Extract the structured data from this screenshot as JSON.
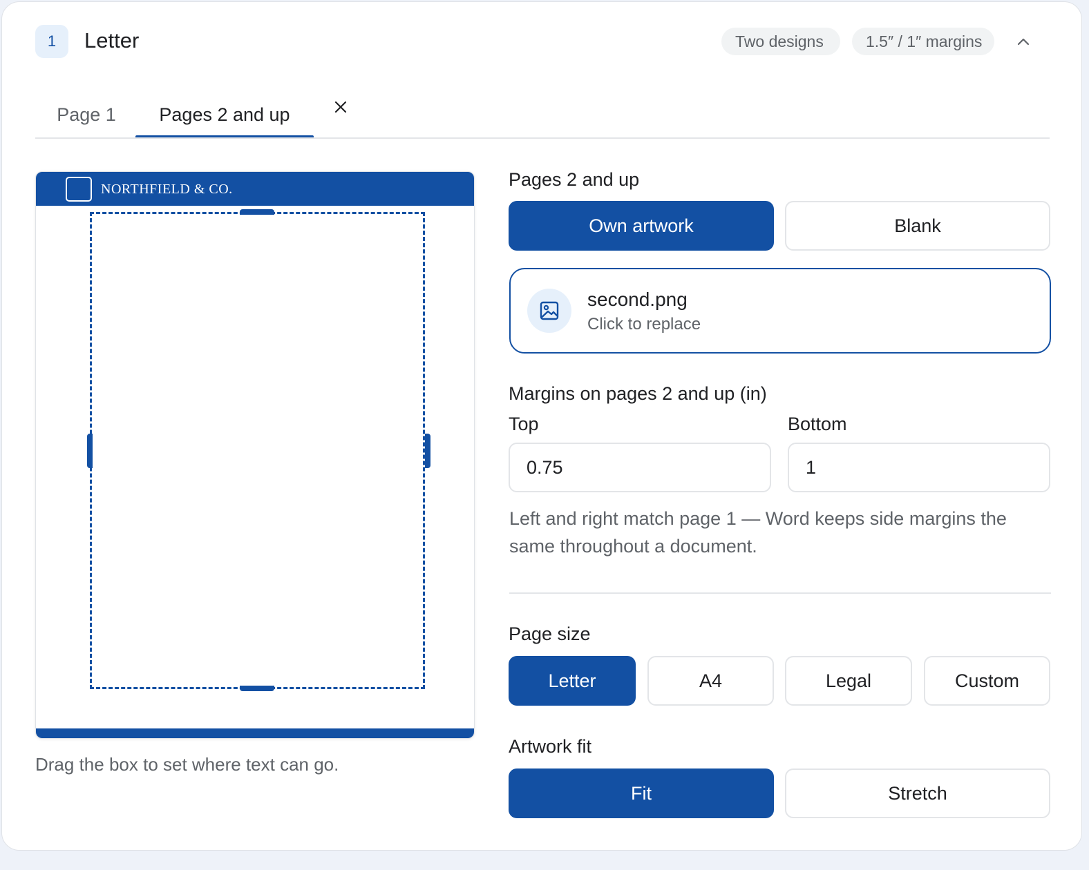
{
  "header": {
    "step_number": "1",
    "title": "Letter",
    "chips": [
      "Two designs",
      "1.5″ / 1″ margins"
    ],
    "collapse_icon": "chevron-up-icon"
  },
  "tabs": [
    {
      "label": "Page 1",
      "active": false
    },
    {
      "label": "Pages 2 and up",
      "active": true
    }
  ],
  "preview": {
    "company_name": "NORTHFIELD & CO.",
    "caption": "Drag the box to set where text can go."
  },
  "pages_section": {
    "label": "Pages 2 and up",
    "options": [
      "Own artwork",
      "Blank"
    ],
    "selected": "Own artwork"
  },
  "file": {
    "icon": "image-icon",
    "name": "second.png",
    "action": "Click to replace"
  },
  "margins": {
    "label": "Margins on pages 2 and up (in)",
    "top_label": "Top",
    "top_value": "0.75",
    "bottom_label": "Bottom",
    "bottom_value": "1",
    "helper": "Left and right match page 1 — Word keeps side margins the same throughout a document."
  },
  "page_size": {
    "label": "Page size",
    "options": [
      "Letter",
      "A4",
      "Legal",
      "Custom"
    ],
    "selected": "Letter"
  },
  "artwork_fit": {
    "label": "Artwork fit",
    "options": [
      "Fit",
      "Stretch"
    ],
    "selected": "Fit"
  },
  "colors": {
    "accent": "#1350a3",
    "accent_light": "#e6f0fb",
    "muted_text": "#5f6368",
    "border": "#e3e5e8"
  }
}
